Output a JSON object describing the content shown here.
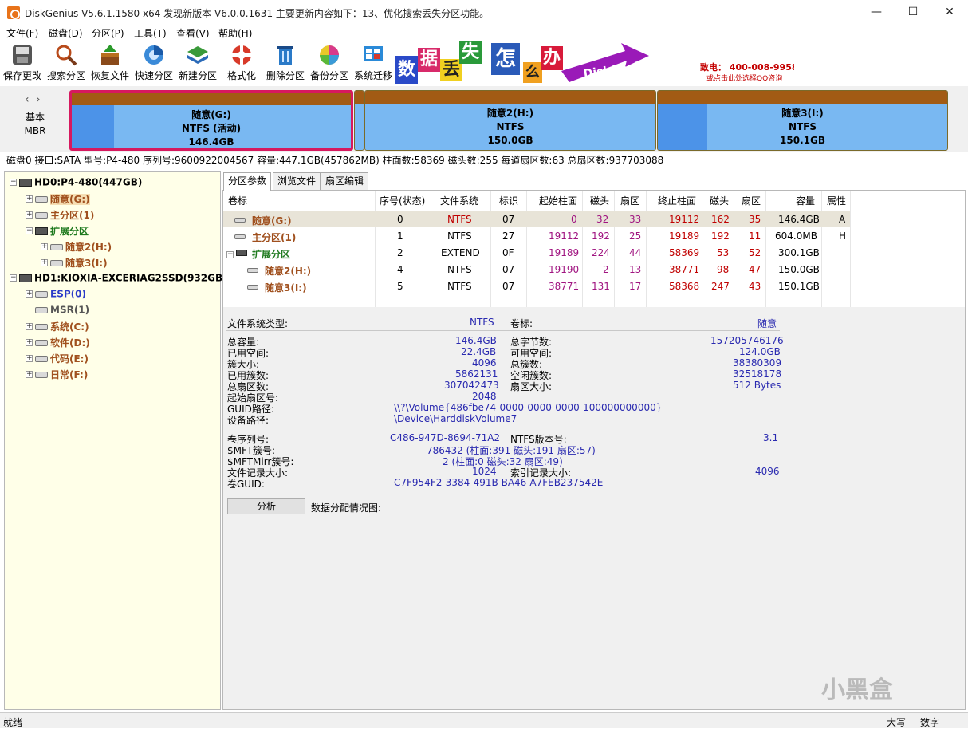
{
  "window": {
    "title": "DiskGenius V5.6.1.1580 x64    发现新版本 V6.0.0.1631    主要更新内容如下：13、优化搜索丢失分区功能。",
    "minimize": "—",
    "maximize": "☐",
    "close": "✕"
  },
  "menu": [
    "文件(F)",
    "磁盘(D)",
    "分区(P)",
    "工具(T)",
    "查看(V)",
    "帮助(H)"
  ],
  "toolbar": [
    {
      "label": "保存更改",
      "icon": "save-disk-icon"
    },
    {
      "label": "搜索分区",
      "icon": "magnifier-icon"
    },
    {
      "label": "恢复文件",
      "icon": "recover-box-icon"
    },
    {
      "label": "快速分区",
      "icon": "quick-partition-icon"
    },
    {
      "label": "新建分区",
      "icon": "new-partition-icon"
    },
    {
      "label": "格式化",
      "icon": "format-lifebuoy-icon"
    },
    {
      "label": "删除分区",
      "icon": "trash-icon"
    },
    {
      "label": "备份分区",
      "icon": "backup-pie-icon"
    },
    {
      "label": "系统迁移",
      "icon": "windows-migrate-icon"
    }
  ],
  "banner": {
    "chars": [
      "数",
      "据",
      "丢",
      "失",
      "怎",
      "么",
      "办"
    ],
    "slogan": "DiskGenius 团队为您服务",
    "phone": "致电： 400-008-9958",
    "qq": "或点击此处选择QQ咨询"
  },
  "diskbar": {
    "nav": "‹ ›",
    "type_line1": "基本",
    "type_line2": "MBR",
    "partitions": [
      {
        "name": "随意(G:)",
        "fs": "NTFS (活动)",
        "size": "146.4GB",
        "used_fraction": 0.15
      },
      {
        "name": "随意2(H:)",
        "fs": "NTFS",
        "size": "150.0GB",
        "used_fraction": 0.0
      },
      {
        "name": "随意3(I:)",
        "fs": "NTFS",
        "size": "150.1GB",
        "used_fraction": 0.17
      }
    ]
  },
  "disk_info": "磁盘0 接口:SATA  型号:P4-480  序列号:9600922004567  容量:447.1GB(457862MB)  柱面数:58369  磁头数:255  每道扇区数:63  总扇区数:937703088",
  "tree": [
    {
      "label": "HD0:P4-480(447GB)",
      "kind": "disk"
    },
    {
      "label": "随意(G:)",
      "kind": "part-selected"
    },
    {
      "label": "主分区(1)",
      "kind": "part"
    },
    {
      "label": "扩展分区",
      "kind": "extended"
    },
    {
      "label": "随意2(H:)",
      "kind": "part"
    },
    {
      "label": "随意3(I:)",
      "kind": "part"
    },
    {
      "label": "HD1:KIOXIA-EXCERIAG2SSD(932GB)",
      "kind": "disk"
    },
    {
      "label": "ESP(0)",
      "kind": "esp"
    },
    {
      "label": "MSR(1)",
      "kind": "msr"
    },
    {
      "label": "系统(C:)",
      "kind": "part"
    },
    {
      "label": "软件(D:)",
      "kind": "part"
    },
    {
      "label": "代码(E:)",
      "kind": "part"
    },
    {
      "label": "日常(F:)",
      "kind": "part"
    }
  ],
  "tabs": [
    "分区参数",
    "浏览文件",
    "扇区编辑"
  ],
  "table": {
    "headers": [
      "卷标",
      "序号(状态)",
      "文件系统",
      "标识",
      "起始柱面",
      "磁头",
      "扇区",
      "终止柱面",
      "磁头",
      "扇区",
      "容量",
      "属性"
    ],
    "rows": [
      [
        "随意(G:)",
        "0",
        "NTFS",
        "07",
        "0",
        "32",
        "33",
        "19112",
        "162",
        "35",
        "146.4GB",
        "A"
      ],
      [
        "主分区(1)",
        "1",
        "NTFS",
        "27",
        "19112",
        "192",
        "25",
        "19189",
        "192",
        "11",
        "604.0MB",
        "H"
      ],
      [
        "扩展分区",
        "2",
        "EXTEND",
        "0F",
        "19189",
        "224",
        "44",
        "58369",
        "53",
        "52",
        "300.1GB",
        ""
      ],
      [
        "随意2(H:)",
        "4",
        "NTFS",
        "07",
        "19190",
        "2",
        "13",
        "38771",
        "98",
        "47",
        "150.0GB",
        ""
      ],
      [
        "随意3(I:)",
        "5",
        "NTFS",
        "07",
        "38771",
        "131",
        "17",
        "58368",
        "247",
        "43",
        "150.1GB",
        ""
      ]
    ]
  },
  "details": {
    "fs_type_label": "文件系统类型:",
    "fs_type": "NTFS",
    "volume_label_label": "卷标:",
    "volume_label": "随意",
    "total_label": "总容量:",
    "total": "146.4GB",
    "total_bytes_label": "总字节数:",
    "total_bytes": "157205746176",
    "used_label": "已用空间:",
    "used": "22.4GB",
    "free_label": "可用空间:",
    "free": "124.0GB",
    "cluster_label": "簇大小:",
    "cluster": "4096",
    "total_clusters_label": "总簇数:",
    "total_clusters": "38380309",
    "used_clusters_label": "已用簇数:",
    "used_clusters": "5862131",
    "free_clusters_label": "空闲簇数:",
    "free_clusters": "32518178",
    "total_sectors_label": "总扇区数:",
    "total_sectors": "307042473",
    "sector_size_label": "扇区大小:",
    "sector_size": "512 Bytes",
    "start_sector_label": "起始扇区号:",
    "start_sector": "2048",
    "guid_path_label": "GUID路径:",
    "guid_path": "\\\\?\\Volume{486fbe74-0000-0000-0000-100000000000}",
    "device_path_label": "设备路径:",
    "device_path": "\\Device\\HarddiskVolume7",
    "serial_label": "卷序列号:",
    "serial": "C486-947D-8694-71A2",
    "ntfs_ver_label": "NTFS版本号:",
    "ntfs_ver": "3.1",
    "mft_label": "$MFT簇号:",
    "mft": "786432 (柱面:391 磁头:191 扇区:57)",
    "mftmirr_label": "$MFTMirr簇号:",
    "mftmirr": "2 (柱面:0 磁头:32 扇区:49)",
    "record_size_label": "文件记录大小:",
    "record_size": "1024",
    "index_size_label": "索引记录大小:",
    "index_size": "4096",
    "vol_guid_label": "卷GUID:",
    "vol_guid": "C7F954F2-3384-491B-BA46-A7FEB237542E",
    "analyze": "分析",
    "alloc_label": "数据分配情况图:"
  },
  "status": {
    "left": "就绪",
    "caps": "大写",
    "num": "数字"
  },
  "watermark": "小黑盒",
  "colors": {
    "accent_selected": "#d6195f",
    "partition_top": "#a25b14",
    "partition_free": "#79b8f2",
    "partition_used": "#4c93e8",
    "tree_bg": "#ffffe8"
  }
}
